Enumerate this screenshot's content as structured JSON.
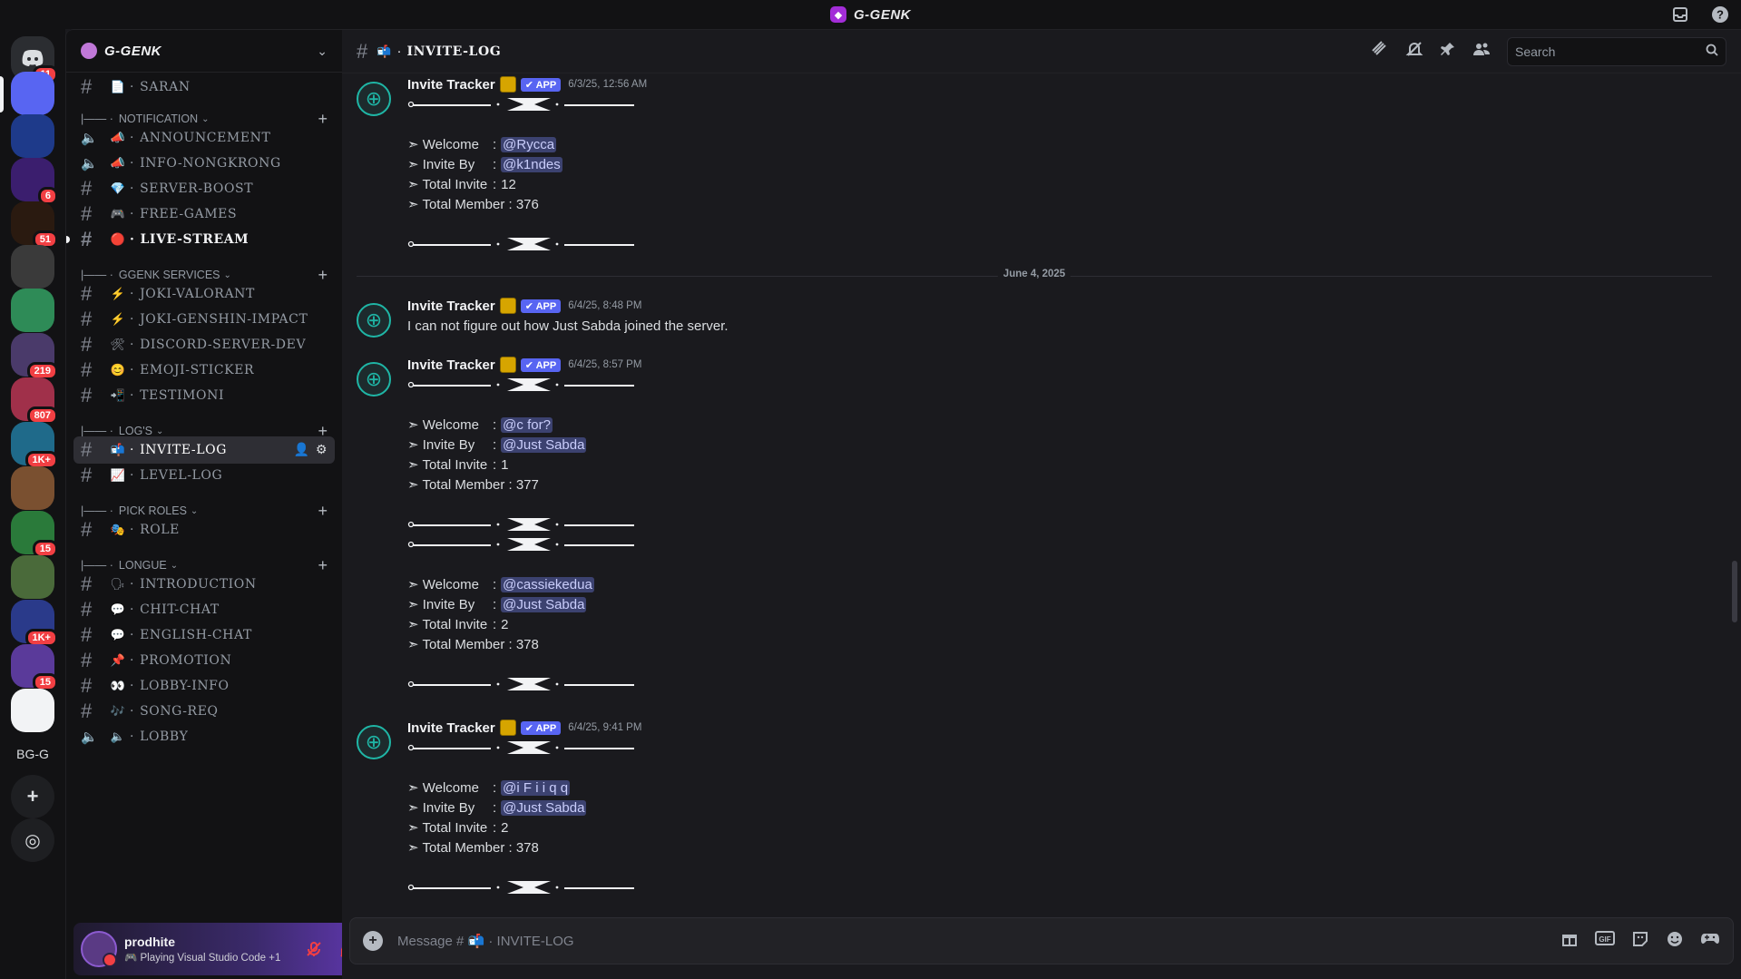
{
  "app": {
    "title": "G-GENK"
  },
  "server": {
    "name": "G-GENK"
  },
  "rail": {
    "home_badge": "11",
    "servers": [
      {
        "label": "",
        "badge": "",
        "color": "#5865f2"
      },
      {
        "label": "",
        "badge": "",
        "color": "#1e3a8a"
      },
      {
        "label": "",
        "badge": "6",
        "color": "#3b1e6e"
      },
      {
        "label": "",
        "badge": "51",
        "color": "#2a1a10"
      },
      {
        "label": "",
        "badge": "",
        "color": "#3a3a3a"
      },
      {
        "label": "",
        "badge": "",
        "color": "#2e8b57"
      },
      {
        "label": "",
        "badge": "219",
        "color": "#4a3a6a"
      },
      {
        "label": "",
        "badge": "807",
        "color": "#a0304a"
      },
      {
        "label": "",
        "badge": "1K+",
        "color": "#1f6a8a"
      },
      {
        "label": "",
        "badge": "",
        "color": "#7a5030"
      },
      {
        "label": "",
        "badge": "15",
        "color": "#2a7a3a"
      },
      {
        "label": "",
        "badge": "",
        "color": "#4a6a3a"
      },
      {
        "label": "",
        "badge": "1K+",
        "color": "#2a3a8a"
      },
      {
        "label": "",
        "badge": "15",
        "color": "#5a3a9a"
      },
      {
        "label": "",
        "badge": "",
        "color": "#f2f3f5"
      },
      {
        "label": "BG-G",
        "badge": "",
        "color": "#121214"
      }
    ]
  },
  "sidebar": {
    "channels_top": [
      {
        "emoji": "📄",
        "name": "SARAN"
      }
    ],
    "categories": {
      "notification": "NOTIFICATION",
      "services": "GGENK SERVICES",
      "logs": "LOG'S",
      "roles": "PICK ROLES",
      "longue": "LONGUE"
    },
    "notification": [
      {
        "emoji": "📣",
        "name": "ANNOUNCEMENT"
      },
      {
        "emoji": "📣",
        "name": "INFO-NONGKRONG"
      },
      {
        "emoji": "💎",
        "name": "SERVER-BOOST"
      },
      {
        "emoji": "🎮",
        "name": "FREE-GAMES"
      },
      {
        "emoji": "🔴",
        "name": "LIVE-STREAM"
      }
    ],
    "services": [
      {
        "emoji": "⚡",
        "name": "JOKI-VALORANT"
      },
      {
        "emoji": "⚡",
        "name": "JOKI-GENSHIN-IMPACT"
      },
      {
        "emoji": "🛠",
        "name": "DISCORD-SERVER-DEV"
      },
      {
        "emoji": "😊",
        "name": "EMOJI-STICKER"
      },
      {
        "emoji": "📲",
        "name": "TESTIMONI"
      }
    ],
    "logs": [
      {
        "emoji": "📬",
        "name": "INVITE-LOG"
      },
      {
        "emoji": "📈",
        "name": "LEVEL-LOG"
      }
    ],
    "roles": [
      {
        "emoji": "🎭",
        "name": "ROLE"
      }
    ],
    "longue": [
      {
        "emoji": "🗣",
        "name": "INTRODUCTION"
      },
      {
        "emoji": "💬",
        "name": "CHIT-CHAT"
      },
      {
        "emoji": "💬",
        "name": "ENGLISH-CHAT"
      },
      {
        "emoji": "📌",
        "name": "PROMOTION"
      },
      {
        "emoji": "👀",
        "name": "LOBBY-INFO"
      },
      {
        "emoji": "🎶",
        "name": "SONG-REQ"
      },
      {
        "emoji": "🔈",
        "name": "LOBBY"
      }
    ]
  },
  "user": {
    "name": "prodhite",
    "status": "Playing Visual Studio Code +1"
  },
  "channel": {
    "emoji": "📬",
    "name": "INVITE-LOG"
  },
  "search": {
    "placeholder": "Search"
  },
  "composer": {
    "placeholder": "Message # 📬 · INVITE-LOG"
  },
  "messages": [
    {
      "author": "Invite Tracker",
      "tag": "APP",
      "time": "6/3/25, 12:56 AM",
      "welcome": "@Rycca",
      "invite_by": "@k1ndes",
      "total_invite": "12",
      "total_member": "376"
    },
    {
      "author": "Invite Tracker",
      "tag": "APP",
      "time": "6/4/25, 8:48 PM",
      "text": "I can not figure out how Just Sabda joined the server."
    },
    {
      "author": "Invite Tracker",
      "tag": "APP",
      "time": "6/4/25, 8:57 PM",
      "welcome": "@c for?",
      "invite_by": "@Just Sabda",
      "total_invite": "1",
      "total_member": "377",
      "welcome2": "@cassiekedua",
      "invite_by2": "@Just Sabda",
      "total_invite2": "2",
      "total_member2": "378"
    },
    {
      "author": "Invite Tracker",
      "tag": "APP",
      "time": "6/4/25, 9:41 PM",
      "welcome": "@i F i i q q",
      "invite_by": "@Just Sabda",
      "total_invite": "2",
      "total_member": "378"
    }
  ],
  "labels": {
    "welcome": "➣ Welcome",
    "invite_by": "➣ Invite By",
    "total_invite": "➣ Total Invite",
    "total_member": "➣ Total Member :"
  },
  "date_divider": "June 4, 2025",
  "colors": {
    "accent": "#5865f2",
    "mention_bg": "#3c4270",
    "badge": "#f23f43",
    "bot_avatar": "#1fb6a6"
  }
}
